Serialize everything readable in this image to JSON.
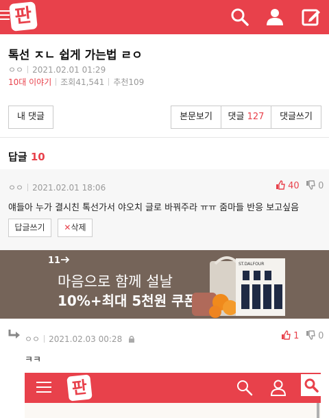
{
  "header": {
    "logo_text": "판",
    "icons": [
      "menu-icon",
      "search-icon",
      "user-icon",
      "write-icon"
    ]
  },
  "post": {
    "title": "톡선 ㅈㄴ 쉽게 가는법 ㄹㅇ",
    "author": "ㅇㅇ",
    "date": "2021.02.01 01:29",
    "category": "10대 이야기",
    "views": "조회41,541",
    "recommends": "추천109"
  },
  "buttons": {
    "my_comments": "내 댓글",
    "view_post": "본문보기",
    "comments_label": "댓글",
    "comments_count": "127",
    "write_comment": "댓글쓰기"
  },
  "replies": {
    "label": "답글",
    "count": "10"
  },
  "comment": {
    "author": "ㅇㅇ",
    "date": "2021.02.01 18:06",
    "text": "얘들아 누가 결시친 톡선가서 야오치 글로 바꿔주라 ㅠㅠ 줌마들 반응 보고싶음",
    "up": "40",
    "down": "0",
    "reply_button": "답글쓰기",
    "delete_button": "삭제"
  },
  "banner": {
    "brand": "11",
    "line1": "마음으로 함께 설날",
    "line2": "10%+최대 5천원 쿠폰",
    "product_label": "ST.DALFOUR",
    "background": "#756459"
  },
  "reply": {
    "author": "ㅇㅇ",
    "date": "2021.02.03 00:28",
    "text": "ㅋㅋ",
    "up": "1",
    "down": "0"
  },
  "colors": {
    "brand": "#e8414b",
    "muted": "#999999"
  }
}
